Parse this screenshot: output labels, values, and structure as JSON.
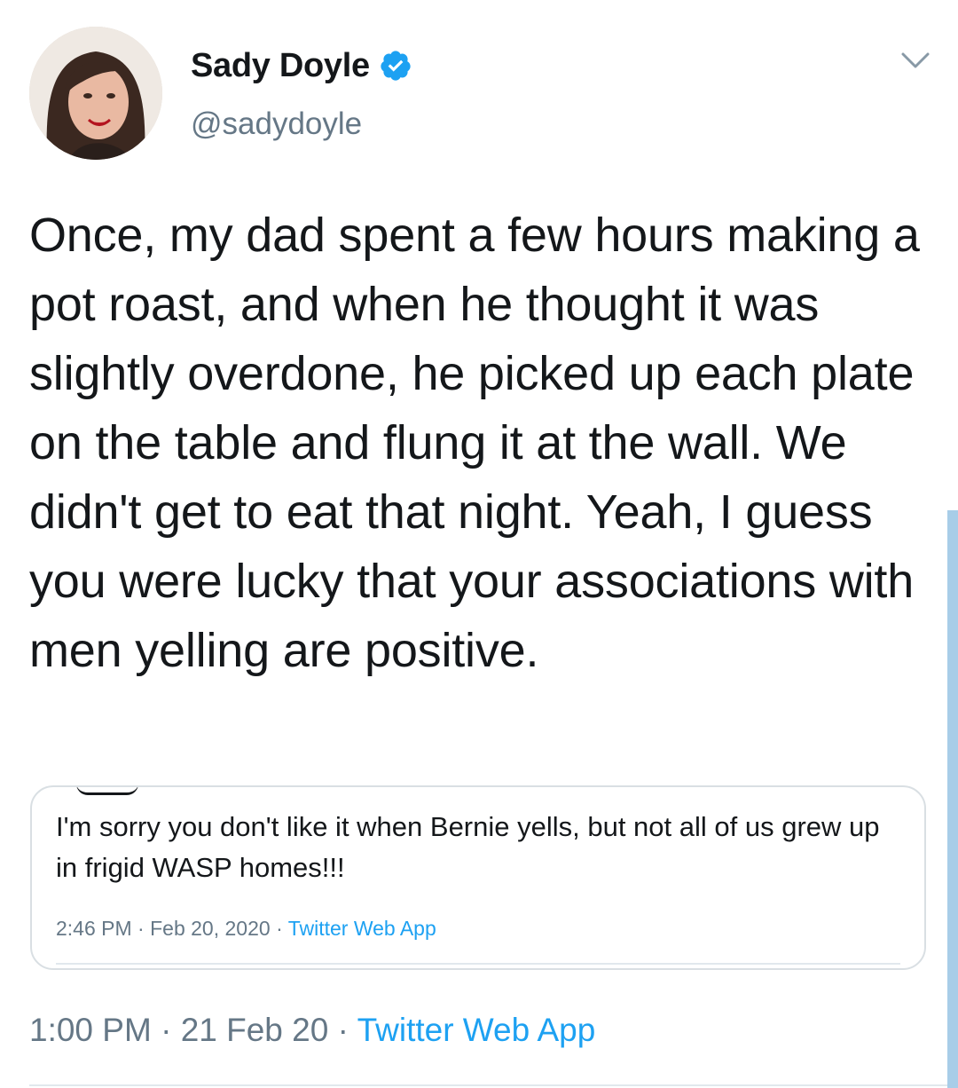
{
  "tweet": {
    "author_name": "Sady Doyle",
    "handle": "@sadydoyle",
    "verified_icon": "verified-badge-icon",
    "menu_icon": "chevron-down-icon",
    "text": "Once, my dad spent a few hours making a pot roast, and when he thought it was slightly overdone, he picked up each plate on the table and flung it at the wall. We didn't get to eat that night. Yeah, I guess you were lucky that your associations with men yelling are positive.",
    "time": "1:00 PM",
    "date": "21 Feb 20",
    "source": "Twitter Web App",
    "separator": "·"
  },
  "quoted": {
    "text": "I'm sorry you don't like it when Bernie yells, but not all of us grew up in frigid WASP homes!!!",
    "time": "2:46 PM",
    "date": "Feb 20, 2020",
    "source": "Twitter Web App",
    "separator": "·"
  },
  "colors": {
    "text": "#14171a",
    "secondary": "#657786",
    "link": "#1da1f2",
    "border": "#d9dfe3",
    "scrollbar": "#a8cde8"
  }
}
